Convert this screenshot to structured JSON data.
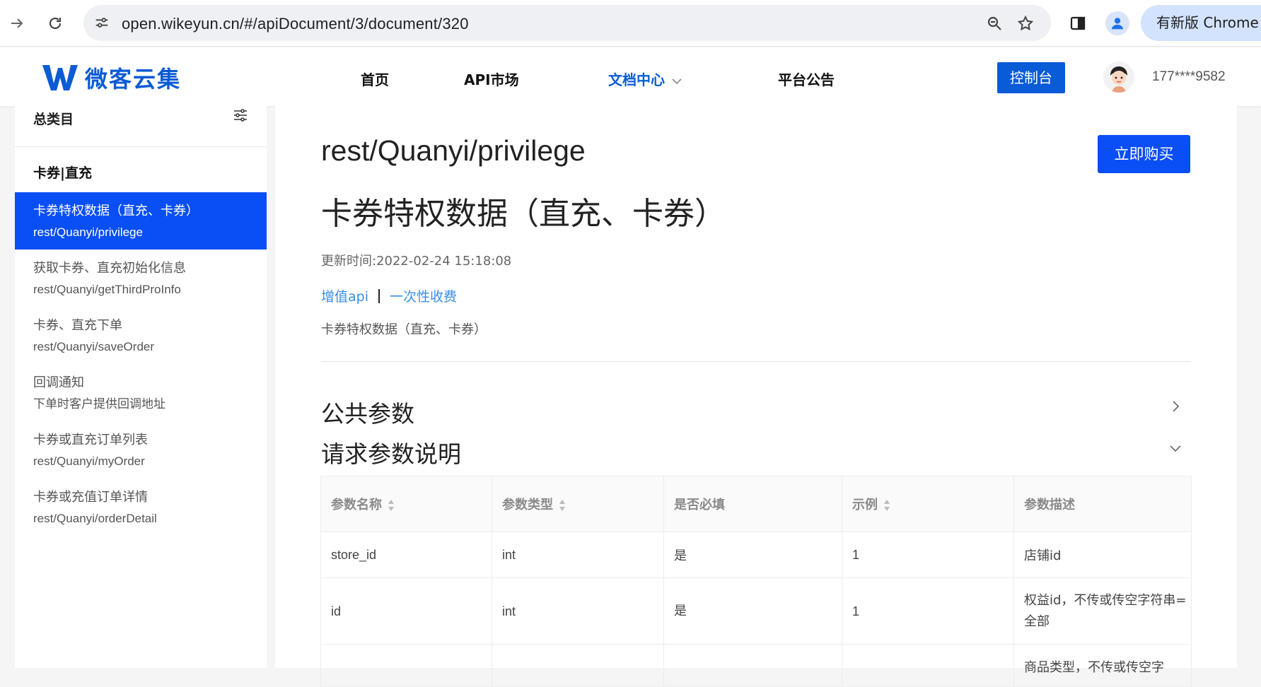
{
  "browser": {
    "url": "open.wikeyun.cn/#/apiDocument/3/document/320",
    "update_label": "有新版 Chrome 可用"
  },
  "site": {
    "logo_text": "微客云集",
    "nav": {
      "home": "首页",
      "api_market": "API市场",
      "docs": "文档中心",
      "announce": "平台公告"
    },
    "console_label": "控制台",
    "username": "177****9582"
  },
  "sidebar": {
    "title": "总类目",
    "category": "卡券|直充",
    "items": [
      {
        "title": "卡券特权数据（直充、卡券）",
        "sub": "rest/Quanyi/privilege"
      },
      {
        "title": "获取卡券、直充初始化信息",
        "sub": "rest/Quanyi/getThirdProInfo"
      },
      {
        "title": "卡券、直充下单",
        "sub": "rest/Quanyi/saveOrder"
      },
      {
        "title": "回调通知",
        "sub": "下单时客户提供回调地址"
      },
      {
        "title": "卡券或直充订单列表",
        "sub": "rest/Quanyi/myOrder"
      },
      {
        "title": "卡券或充值订单详情",
        "sub": "rest/Quanyi/orderDetail"
      }
    ]
  },
  "doc": {
    "path": "rest/Quanyi/privilege",
    "title": "卡券特权数据（直充、卡券）",
    "buy_label": "立即购买",
    "updated": "更新时间:2022-02-24 15:18:08",
    "tag1": "增值api",
    "tag2": "一次性收费",
    "description": "卡券特权数据（直充、卡券）",
    "section_public": "公共参数",
    "section_request": "请求参数说明"
  },
  "table": {
    "headers": [
      "参数名称",
      "参数类型",
      "是否必填",
      "示例",
      "参数描述"
    ],
    "rows": [
      [
        "store_id",
        "int",
        "是",
        "1",
        "店铺id"
      ],
      [
        "id",
        "int",
        "是",
        "1",
        "权益id，不传或传空字符串=全部"
      ],
      [
        "",
        "",
        "",
        "",
        "商品类型，不传或传空字"
      ]
    ]
  }
}
